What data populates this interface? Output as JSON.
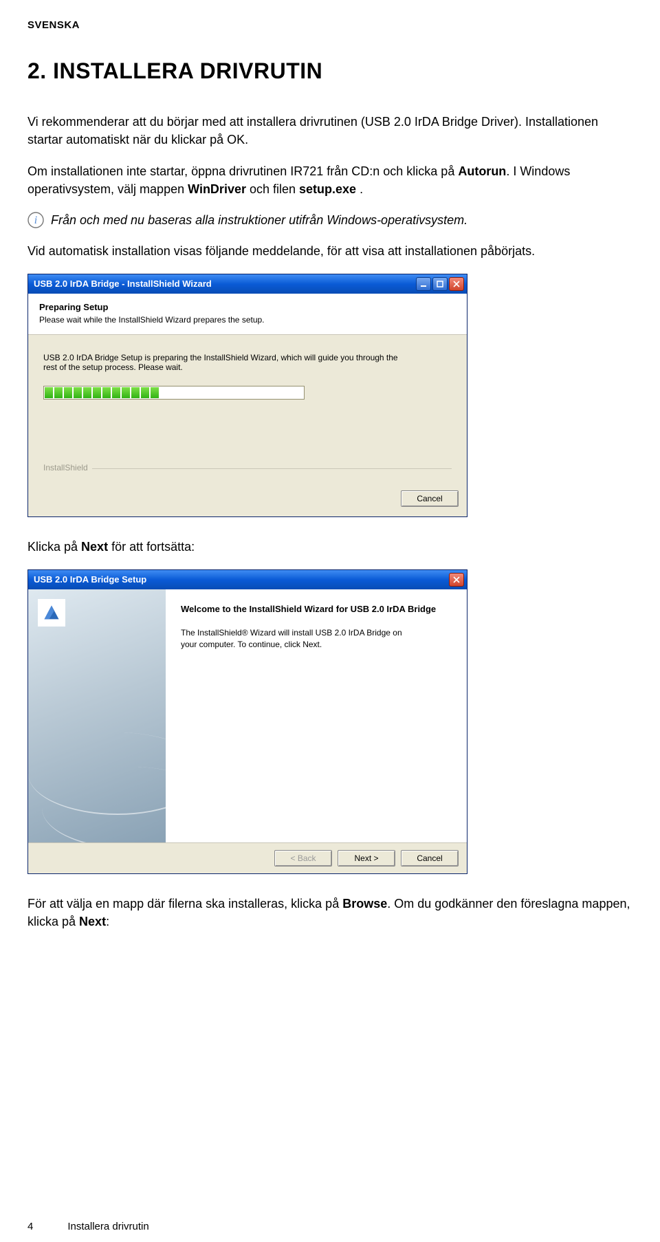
{
  "header": {
    "language": "SVENSKA"
  },
  "section": {
    "title": "2. INSTALLERA DRIVRUTIN",
    "p1": "Vi rekommenderar att du börjar med att installera drivrutinen (USB 2.0 IrDA Bridge Driver). Installationen startar automatiskt när du klickar på OK.",
    "p2_a": "Om installationen inte startar, öppna drivrutinen IR721 från CD:n och klicka på ",
    "p2_b_bold": "Autorun",
    "p2_c": ". I Windows operativsystem, välj mappen ",
    "p2_d_bold": "WinDriver",
    "p2_e": " och filen ",
    "p2_f_bold": "setup.exe",
    "p2_g": " .",
    "info": "Från och med nu baseras alla instruktioner utifrån Windows-operativsystem.",
    "p3": "Vid automatisk installation visas följande meddelande, för att visa att installationen påbörjats.",
    "p4_a": "Klicka på ",
    "p4_b_bold": "Next",
    "p4_c": " för att fortsätta:",
    "p5_a": "För att välja en mapp där filerna ska installeras, klicka på ",
    "p5_b_bold": "Browse",
    "p5_c": ". Om du godkänner den föreslagna mappen, klicka på ",
    "p5_d_bold": "Next",
    "p5_e": ":"
  },
  "dialog1": {
    "title": "USB 2.0 IrDA Bridge - InstallShield Wizard",
    "prep_title": "Preparing Setup",
    "prep_sub": "Please wait while the InstallShield Wizard prepares the setup.",
    "body_text": "USB 2.0 IrDA Bridge Setup is preparing the InstallShield Wizard, which will guide you through the rest of the setup process. Please wait.",
    "brand": "InstallShield",
    "cancel": "Cancel"
  },
  "dialog2": {
    "title": "USB 2.0 IrDA Bridge Setup",
    "welcome_title": "Welcome to the InstallShield Wizard for USB 2.0 IrDA Bridge",
    "welcome_body": "The InstallShield® Wizard will install USB 2.0 IrDA Bridge on your computer.  To continue, click Next.",
    "back": "< Back",
    "next": "Next >",
    "cancel": "Cancel"
  },
  "footer": {
    "page": "4",
    "title": "Installera drivrutin"
  }
}
